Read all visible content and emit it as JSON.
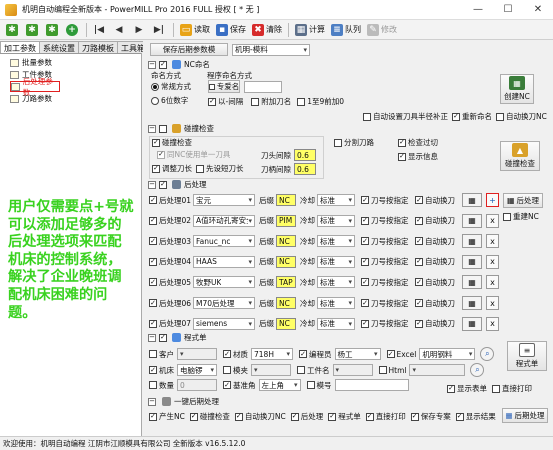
{
  "window": {
    "title": "机明自动编程全新版本 - PowerMILL Pro 2016 FULL 授权 [ * 无 ]"
  },
  "toolbar": {
    "read": "读取",
    "save": "保存",
    "clear": "清除",
    "calc": "计算",
    "queue": "队列",
    "edit": "修改"
  },
  "left_tabs": [
    "加工参数",
    "系统设置",
    "刀路模板",
    "工具箱"
  ],
  "tree": [
    "批量参数",
    "工件参数",
    "后处理参数",
    "刀路参数"
  ],
  "promo": "用户仅需要点+号就可以添加足够多的后处理选项来匹配机床的控制系统，解决了企业晚班调配机床困难的问题。",
  "top": {
    "save_btn": "保存后期参数模",
    "preset": "机明-模料"
  },
  "nc": {
    "header": "NC命名",
    "naming_label": "命名方式",
    "naming_options": [
      "常规方式",
      "6位数字"
    ],
    "program_naming_label": "程序命名方式",
    "exclusive_label": "专爱名",
    "opt_dash": "以-间隔",
    "opt_tool": "附加刀名",
    "opt_zero": "1至9前加0",
    "create_btn": "创建NC",
    "opt_auto_radius": "自动设置刀具半径补正",
    "opt_rename": "重新命名",
    "opt_auto_tool": "自动换刀NC"
  },
  "collision": {
    "header": "碰撞检查",
    "check": "碰撞检查",
    "one_tool": "同NC使用单一刀具",
    "adjust_len": "调整刀长",
    "first_short": "先设短刀长",
    "shank_gap_label": "刀头间隙",
    "shank_gap": "0.6",
    "holder_gap_label": "刀柄间隙",
    "holder_gap": "0.6",
    "split": "分割刀路",
    "check_cut": "检查过切",
    "show_info": "显示信息",
    "btn": "碰撞检查"
  },
  "post": {
    "header": "后处理",
    "rows": [
      {
        "name": "后处理01",
        "machine": "宝元",
        "code_label": "后缀",
        "ext": "NC",
        "cool_label": "冷却",
        "cool": "标准",
        "tool_spec": "刀号按指定",
        "auto_change": "自动换刀",
        "action": "+"
      },
      {
        "name": "后处理02",
        "machine": "A值环动孔寄安全",
        "code_label": "后缀",
        "ext": "PIM",
        "cool_label": "冷却",
        "cool": "标准",
        "tool_spec": "刀号按指定",
        "auto_change": "自动换刀",
        "action": "x"
      },
      {
        "name": "后处理03",
        "machine": "Fanuc_nc",
        "code_label": "后缀",
        "ext": "NC",
        "cool_label": "冷却",
        "cool": "标准",
        "tool_spec": "刀号按指定",
        "auto_change": "自动换刀",
        "action": "x"
      },
      {
        "name": "后处理04",
        "machine": "HAAS",
        "code_label": "后缀",
        "ext": "NC",
        "cool_label": "冷却",
        "cool": "标准",
        "tool_spec": "刀号按指定",
        "auto_change": "自动换刀",
        "action": "x"
      },
      {
        "name": "后处理05",
        "machine": "牧野UK",
        "code_label": "后缀",
        "ext": "TAP",
        "cool_label": "冷却",
        "cool": "标准",
        "tool_spec": "刀号按指定",
        "auto_change": "自动换刀",
        "action": "x"
      },
      {
        "name": "后处理06",
        "machine": "M70后处理",
        "code_label": "后缀",
        "ext": "NC",
        "cool_label": "冷却",
        "cool": "标准",
        "tool_spec": "刀号按指定",
        "auto_change": "自动换刀",
        "action": "x"
      },
      {
        "name": "后处理07",
        "machine": "siemens",
        "code_label": "后缀",
        "ext": "NC",
        "cool_label": "冷却",
        "cool": "标准",
        "tool_spec": "刀号按指定",
        "auto_change": "自动换刀",
        "action": "x"
      }
    ],
    "process_btn": "后处理",
    "rebuild": "重建NC"
  },
  "program": {
    "header": "程式单",
    "customer": "客户",
    "material_label": "材质",
    "material": "718H",
    "programmer_label": "编程员",
    "programmer": "杨工",
    "excel": "Excel",
    "excel_template": "机明钢料",
    "machine_label": "机床",
    "machine": "电脑锣",
    "mold_label": "模夹",
    "part_label": "工件名",
    "html": "Html",
    "qty_label": "数量",
    "qty": "0",
    "datum_label": "基准角",
    "datum": "左上角",
    "mold_no_label": "模号",
    "show_sheet": "显示表单",
    "direct_print": "直接打印",
    "btn": "程式单"
  },
  "oneclick": {
    "header": "一键后期处理",
    "items": [
      "产生NC",
      "碰撞检查",
      "自动换刀NC",
      "后处理",
      "程式单",
      "直接打印",
      "保存专案",
      "显示结果"
    ],
    "btn": "后期处理"
  },
  "status": "欢迎使用：机明自动编程  江阴市江顺模具有限公司  全新版本 v16.5.12.0"
}
